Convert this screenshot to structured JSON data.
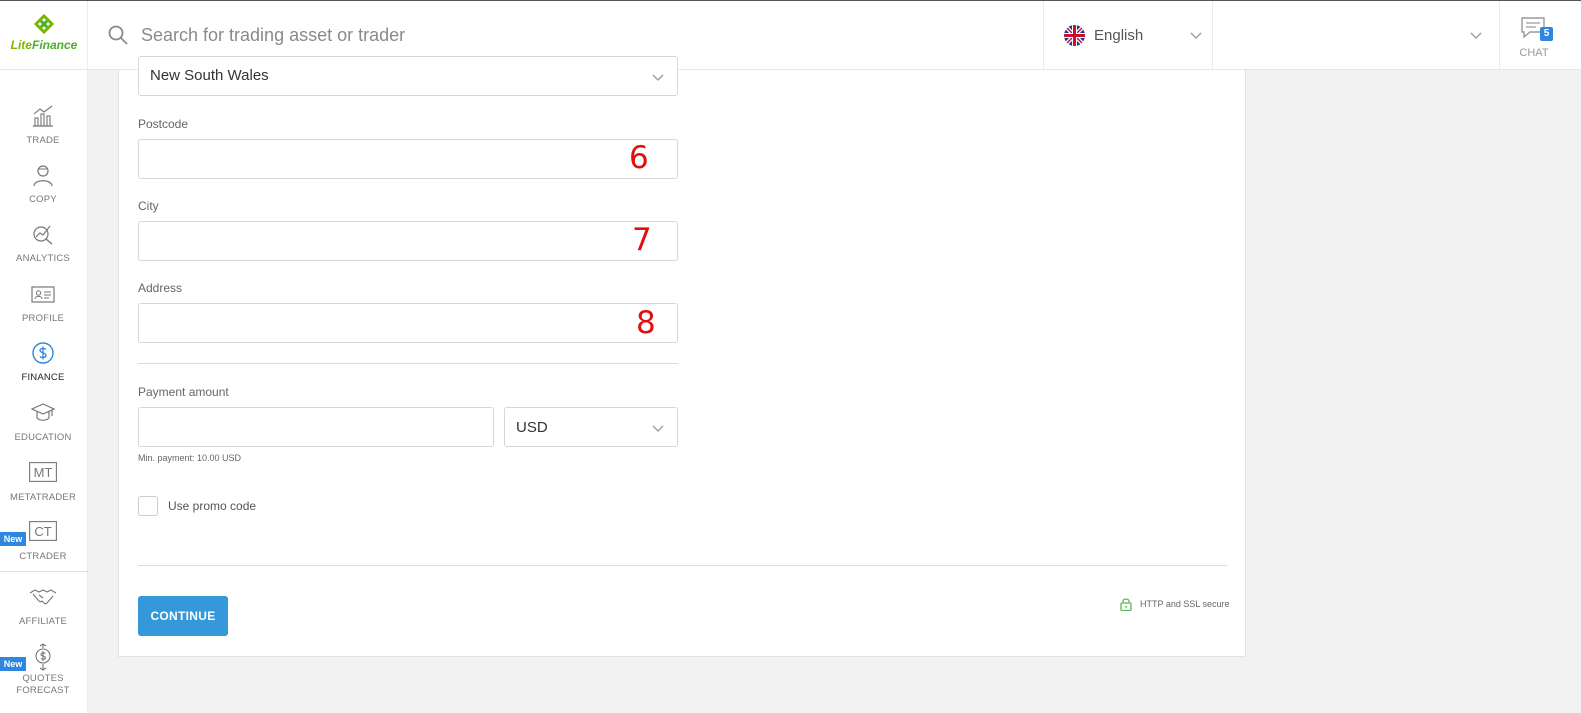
{
  "brand": {
    "logo_text_part1": "Lite",
    "logo_text_part2": "Finance",
    "color_primary": "#7ab800",
    "color_accent": "#3498db"
  },
  "header": {
    "search_placeholder": "Search for trading asset or trader",
    "language": {
      "label": "English",
      "flag_icon": "uk-flag-icon"
    },
    "chat": {
      "label": "CHAT",
      "badge_count": "5"
    }
  },
  "sidebar": {
    "items": [
      {
        "label": "TRADE",
        "icon": "chart-icon",
        "active": false
      },
      {
        "label": "COPY",
        "icon": "user-icon",
        "active": false
      },
      {
        "label": "ANALYTICS",
        "icon": "analytics-icon",
        "active": false
      },
      {
        "label": "PROFILE",
        "icon": "id-card-icon",
        "active": false
      },
      {
        "label": "FINANCE",
        "icon": "dollar-circle-icon",
        "active": true
      },
      {
        "label": "EDUCATION",
        "icon": "graduation-cap-icon",
        "active": false
      },
      {
        "label": "METATRADER",
        "icon": "mt-icon",
        "icon_text": "MT",
        "active": false
      },
      {
        "label": "CTRADER",
        "icon": "ct-icon",
        "icon_text": "CT",
        "badge": "New",
        "active": false
      },
      {
        "label": "AFFILIATE",
        "icon": "handshake-icon",
        "active": false
      },
      {
        "label_line1": "QUOTES",
        "label_line2": "FORECAST",
        "icon": "quotes-forecast-icon",
        "badge": "New",
        "active": false
      }
    ]
  },
  "form": {
    "region": {
      "value": "New South Wales"
    },
    "postcode": {
      "label": "Postcode",
      "value": "",
      "annotation": "6"
    },
    "city": {
      "label": "City",
      "value": "",
      "annotation": "7"
    },
    "address": {
      "label": "Address",
      "value": "",
      "annotation": "8"
    },
    "payment": {
      "label": "Payment amount",
      "value": "",
      "currency": "USD",
      "hint": "Min. payment: 10.00 USD"
    },
    "promo": {
      "label": "Use promo code",
      "checked": false
    },
    "continue_label": "CONTINUE",
    "secure_label": "HTTP and SSL secure"
  }
}
